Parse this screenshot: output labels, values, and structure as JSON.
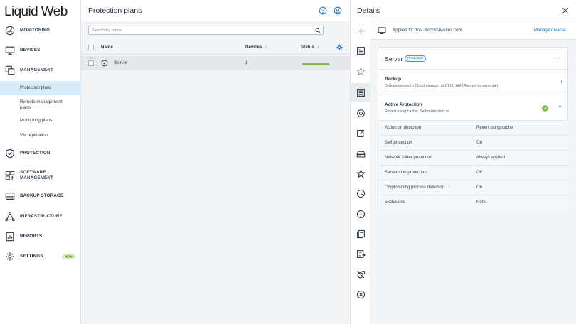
{
  "brand": {
    "logo": "Liquid Web"
  },
  "sidebar": {
    "items": [
      {
        "label": "MONITORING",
        "icon": "gauge-icon"
      },
      {
        "label": "DEVICES",
        "icon": "monitor-icon"
      },
      {
        "label": "MANAGEMENT",
        "icon": "layers-icon"
      },
      {
        "label": "PROTECTION",
        "icon": "shield-icon"
      },
      {
        "label": "SOFTWARE",
        "label2": "MANAGEMENT",
        "icon": "software-icon"
      },
      {
        "label": "BACKUP STORAGE",
        "icon": "storage-icon"
      },
      {
        "label": "INFRASTRUCTURE",
        "icon": "network-icon"
      },
      {
        "label": "REPORTS",
        "icon": "report-icon"
      },
      {
        "label": "SETTINGS",
        "icon": "gear-icon",
        "badge": "NEW"
      }
    ],
    "management_sub": [
      {
        "label": "Protection plans",
        "active": true
      },
      {
        "label": "Remote management",
        "label2": "plans"
      },
      {
        "label": "Monitoring plans"
      },
      {
        "label": "VM replication"
      }
    ]
  },
  "main": {
    "title": "Protection plans",
    "search_placeholder": "Search by name",
    "columns": {
      "name": "Name",
      "devices": "Devices",
      "status": "Status"
    },
    "rows": [
      {
        "name": "Server",
        "devices": "1",
        "status_level": 1.0,
        "status_color": "#7ac143"
      }
    ]
  },
  "details": {
    "title": "Details",
    "applied_to": "Applied to: host.dxxxx0-lwsites.com",
    "manage_link": "Manage devices",
    "plan_name": "Server",
    "plan_badge": "Protection",
    "more": "···",
    "backup": {
      "title": "Backup",
      "subtitle": "Disks/volumes to Cloud storage, at 01:00 AM (Always incremental)"
    },
    "active_protection": {
      "title": "Active Protection",
      "subtitle": "Revert using cache; Self-protection on",
      "properties": [
        {
          "key": "Action on detection",
          "value": "Revert using cache"
        },
        {
          "key": "Self-protection",
          "value": "On"
        },
        {
          "key": "Network folder protection",
          "value": "Always applied"
        },
        {
          "key": "Server-side protection",
          "value": "Off"
        },
        {
          "key": "Cryptomining process detection",
          "value": "On"
        },
        {
          "key": "Exclusions",
          "value": "None"
        }
      ]
    }
  },
  "colors": {
    "accent": "#1f6fb5",
    "ok": "#7ac143",
    "active_nav": "#d9ebf8"
  }
}
